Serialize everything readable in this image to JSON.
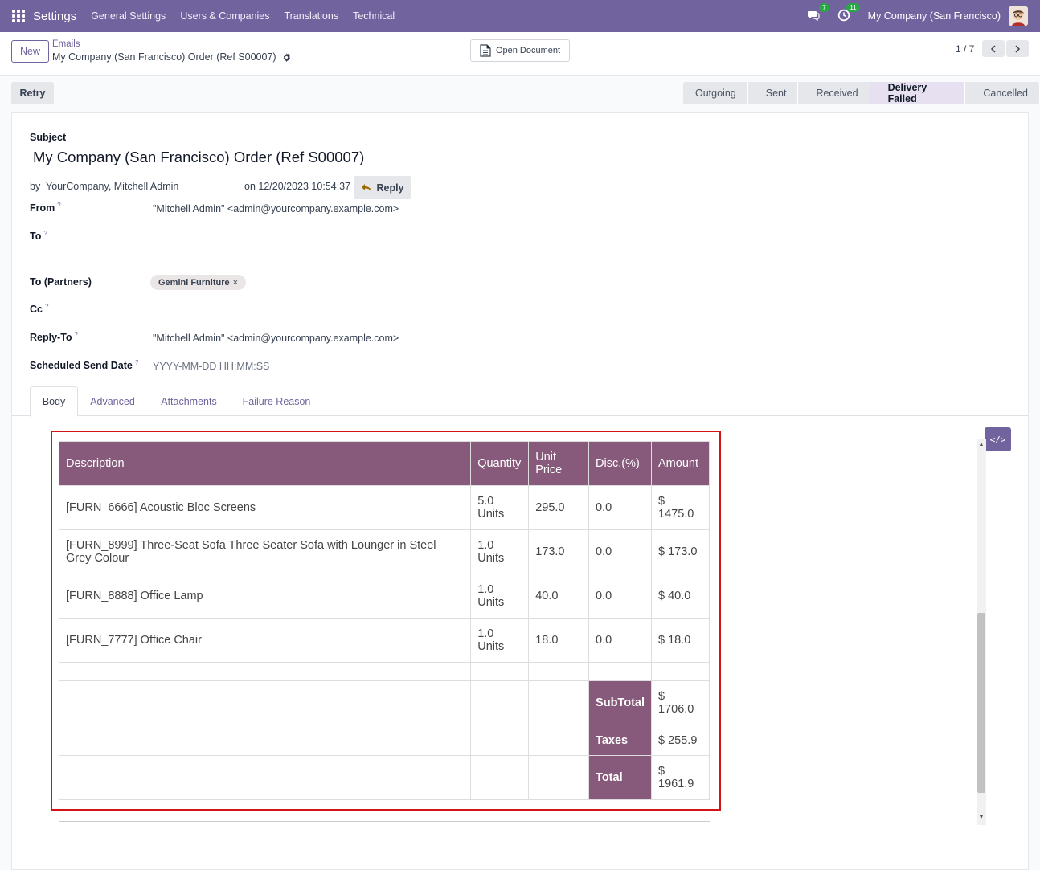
{
  "nav": {
    "brand": "Settings",
    "items": [
      "General Settings",
      "Users & Companies",
      "Translations",
      "Technical"
    ],
    "messages_count": "7",
    "activities_count": "11",
    "company": "My Company (San Francisco)"
  },
  "control": {
    "new_label": "New",
    "breadcrumb_parent": "Emails",
    "breadcrumb_current": "My Company (San Francisco) Order (Ref S00007)",
    "open_document_label": "Open Document",
    "pager": "1 / 7"
  },
  "actions": {
    "retry_label": "Retry",
    "stages": [
      {
        "label": "Outgoing",
        "active": false
      },
      {
        "label": "Sent",
        "active": false
      },
      {
        "label": "Received",
        "active": false
      },
      {
        "label": "Delivery Failed",
        "active": true
      },
      {
        "label": "Cancelled",
        "active": false
      }
    ]
  },
  "form": {
    "subject_label": "Subject",
    "subject": "My Company (San Francisco) Order (Ref S00007)",
    "by_prefix": "by",
    "author": "YourCompany, Mitchell Admin",
    "date": "on 12/20/2023 10:54:37",
    "reply_label": "Reply",
    "from_label": "From",
    "from_value": "\"Mitchell Admin\" <admin@yourcompany.example.com>",
    "to_label": "To",
    "to_partners_label": "To (Partners)",
    "partner_tag": "Gemini Furniture",
    "cc_label": "Cc",
    "reply_to_label": "Reply-To",
    "reply_to_value": "\"Mitchell Admin\" <admin@yourcompany.example.com>",
    "scheduled_label": "Scheduled Send Date",
    "scheduled_placeholder": "YYYY-MM-DD HH:MM:SS",
    "help_mark": "?"
  },
  "tabs": [
    "Body",
    "Advanced",
    "Attachments",
    "Failure Reason"
  ],
  "table": {
    "headers": [
      "Description",
      "Quantity",
      "Unit Price",
      "Disc.(%)",
      "Amount"
    ],
    "rows": [
      {
        "desc": "[FURN_6666] Acoustic Bloc Screens",
        "qty": "5.0 Units",
        "price": "295.0",
        "disc": "0.0",
        "amount": "$ 1475.0"
      },
      {
        "desc": "[FURN_8999] Three-Seat Sofa Three Seater Sofa with Lounger in Steel Grey Colour",
        "qty": "1.0 Units",
        "price": "173.0",
        "disc": "0.0",
        "amount": "$ 173.0"
      },
      {
        "desc": "[FURN_8888] Office Lamp",
        "qty": "1.0 Units",
        "price": "40.0",
        "disc": "0.0",
        "amount": "$ 40.0"
      },
      {
        "desc": "[FURN_7777] Office Chair",
        "qty": "1.0 Units",
        "price": "18.0",
        "disc": "0.0",
        "amount": "$ 18.0"
      }
    ],
    "subtotal_label": "SubTotal",
    "subtotal": "$ 1706.0",
    "taxes_label": "Taxes",
    "taxes": "$ 255.9",
    "total_label": "Total",
    "total": "$ 1961.9"
  },
  "code_view_label": "</>",
  "colors": {
    "nav": "#71639e",
    "table_header": "#875a7b",
    "frame": "#d21414"
  }
}
